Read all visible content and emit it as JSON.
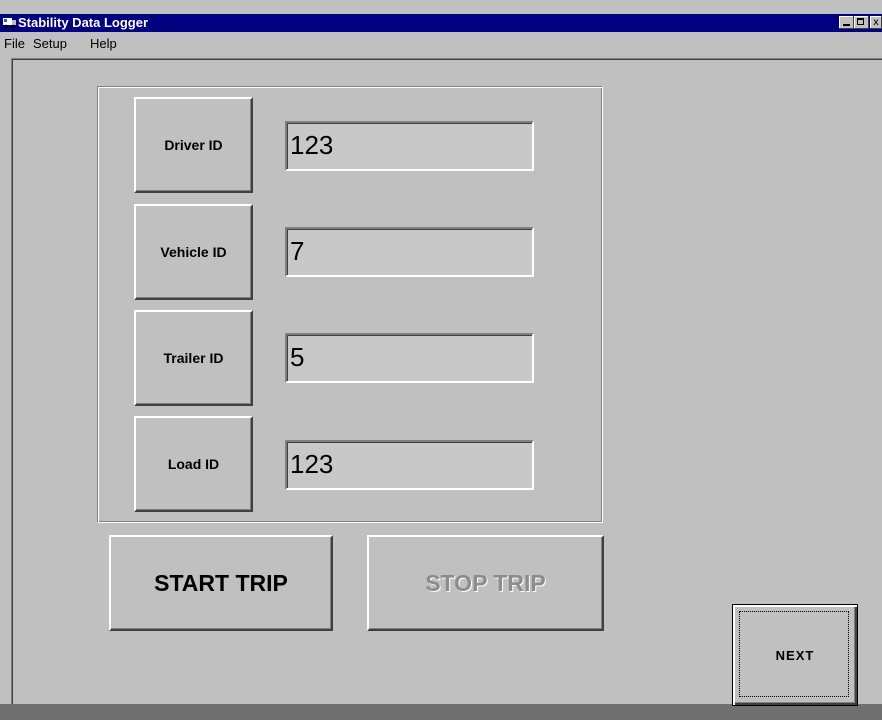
{
  "window": {
    "title": "Stability Data Logger",
    "title_bar_color": "#000080",
    "icon": "truck-app-icon",
    "controls": {
      "close_glyph": "x"
    }
  },
  "menu": {
    "items": [
      "File",
      "Setup",
      "Help"
    ]
  },
  "fields": [
    {
      "label": "Driver ID",
      "value": "123"
    },
    {
      "label": "Vehicle ID",
      "value": "7"
    },
    {
      "label": "Trailer ID",
      "value": "5"
    },
    {
      "label": "Load ID",
      "value": "123"
    }
  ],
  "buttons": {
    "start_trip": "START TRIP",
    "stop_trip": "STOP TRIP",
    "stop_trip_enabled": false,
    "next": "NEXT"
  }
}
